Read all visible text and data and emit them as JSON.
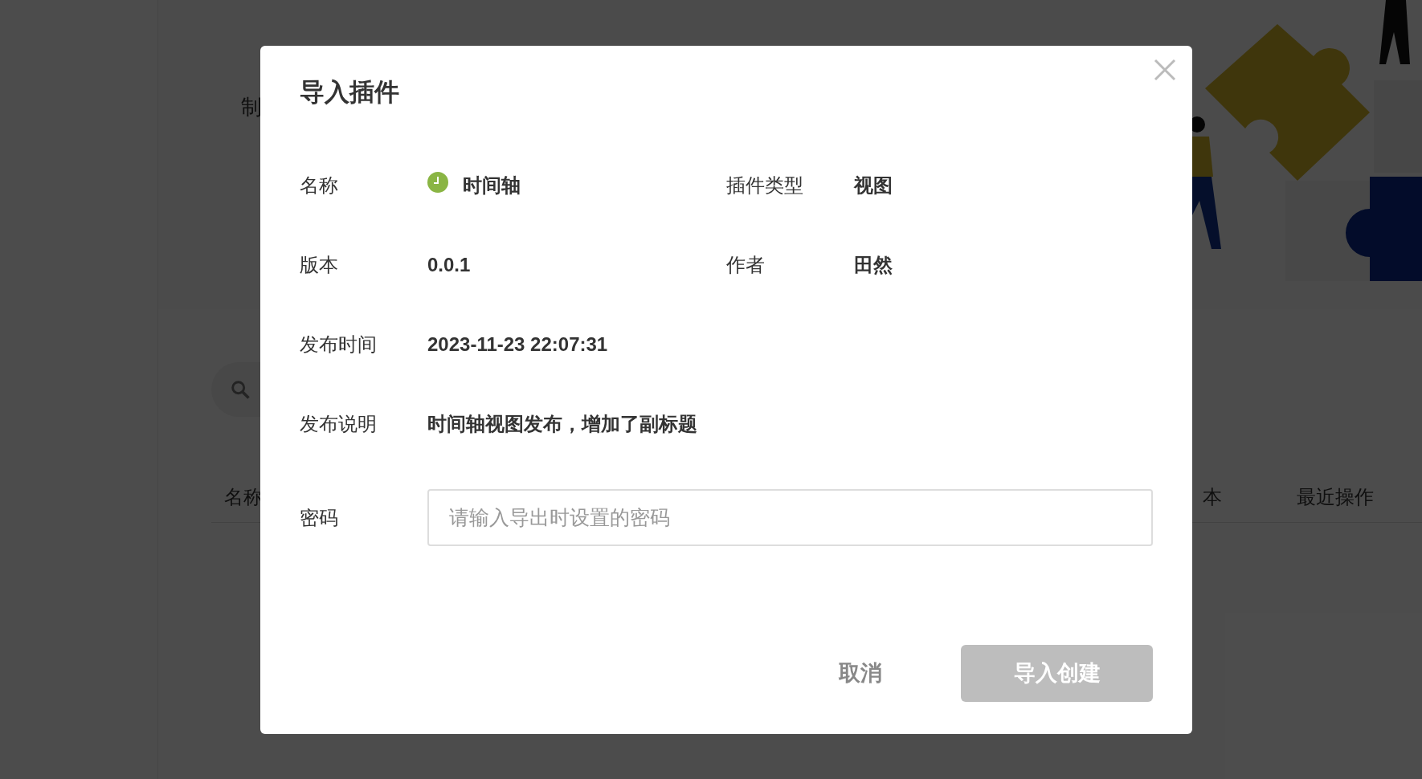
{
  "background": {
    "subtitle": "制",
    "columns": [
      "名称",
      "本",
      "最近操作"
    ]
  },
  "dialog": {
    "title": "导入插件",
    "rows": [
      [
        {
          "label": "名称",
          "value": "时间轴",
          "kind": "icon"
        },
        {
          "label": "插件类型",
          "value": "视图",
          "kind": "text"
        }
      ],
      [
        {
          "label": "版本",
          "value": "0.0.1",
          "kind": "text"
        },
        {
          "label": "作者",
          "value": "田然",
          "kind": "text"
        }
      ],
      [
        {
          "label": "发布时间",
          "value": "2023-11-23 22:07:31",
          "kind": "text"
        }
      ],
      [
        {
          "label": "发布说明",
          "value": "时间轴视图发布，增加了副标题",
          "kind": "text"
        }
      ]
    ],
    "password": {
      "label": "密码",
      "placeholder": "请输入导出时设置的密码"
    },
    "buttons": [
      {
        "label": "取消",
        "kind": "text",
        "disabled": false
      },
      {
        "label": "导入创建",
        "kind": "primary",
        "disabled": true
      }
    ]
  }
}
